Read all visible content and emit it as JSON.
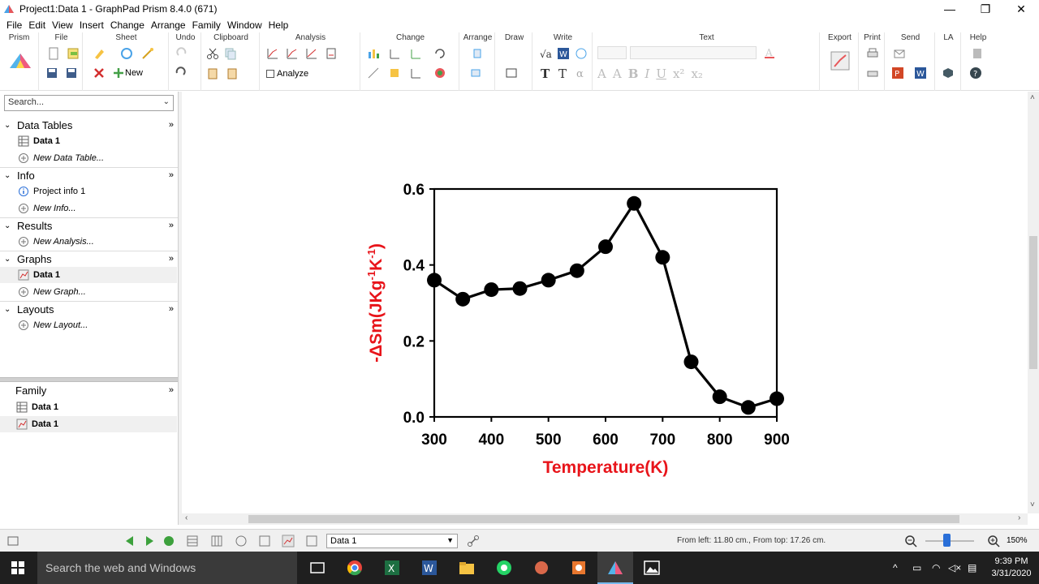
{
  "window": {
    "title": "Project1:Data 1 - GraphPad Prism 8.4.0 (671)",
    "controls": {
      "minimize": "—",
      "restore": "❐",
      "close": "✕"
    }
  },
  "menu": [
    "File",
    "Edit",
    "View",
    "Insert",
    "Change",
    "Arrange",
    "Family",
    "Window",
    "Help"
  ],
  "ribbon": {
    "groups": [
      "Prism",
      "File",
      "Sheet",
      "Undo",
      "Clipboard",
      "Analysis",
      "Change",
      "Arrange",
      "Draw",
      "Write",
      "Text",
      "Export",
      "Print",
      "Send",
      "LA",
      "Help"
    ],
    "new_label": "New",
    "analyze_label": "Analyze"
  },
  "navigator": {
    "search_placeholder": "Search...",
    "sections": [
      {
        "label": "Data Tables",
        "items": [
          {
            "label": "Data 1",
            "style": "bold"
          },
          {
            "label": "New Data Table...",
            "style": "italic"
          }
        ]
      },
      {
        "label": "Info",
        "items": [
          {
            "label": "Project info 1",
            "style": "normal"
          },
          {
            "label": "New Info...",
            "style": "italic"
          }
        ]
      },
      {
        "label": "Results",
        "items": [
          {
            "label": "New Analysis...",
            "style": "italic"
          }
        ]
      },
      {
        "label": "Graphs",
        "items": [
          {
            "label": "Data 1",
            "style": "bold",
            "selected": true
          },
          {
            "label": "New Graph...",
            "style": "italic"
          }
        ]
      },
      {
        "label": "Layouts",
        "items": [
          {
            "label": "New Layout...",
            "style": "italic"
          }
        ]
      }
    ]
  },
  "family": {
    "title": "Family",
    "items": [
      "Data 1",
      "Data 1"
    ]
  },
  "chart_data": {
    "type": "line",
    "x": [
      300,
      350,
      400,
      450,
      500,
      550,
      600,
      650,
      700,
      750,
      800,
      850,
      900
    ],
    "series": [
      {
        "values": [
          0.36,
          0.31,
          0.335,
          0.338,
          0.36,
          0.385,
          0.448,
          0.562,
          0.42,
          0.145,
          0.053,
          0.025,
          0.048
        ],
        "color": "#000000",
        "marker": "circle"
      }
    ],
    "xlabel": "Temperature(K)",
    "ylabel_main": "-ΔSm(JKg",
    "ylabel_sup1": "-1",
    "ylabel_mid": "K",
    "ylabel_sup2": "-1",
    "ylabel_end": ")",
    "label_color": "#e8141a",
    "xlim": [
      300,
      900
    ],
    "ylim": [
      0,
      0.6
    ],
    "xticks": [
      "300",
      "400",
      "500",
      "600",
      "700",
      "800",
      "900"
    ],
    "yticks": [
      "0.0",
      "0.2",
      "0.4",
      "0.6"
    ],
    "grid": false
  },
  "status": {
    "sheet_select": "Data 1",
    "coords": "From left: 11.80 cm., From top: 17.26 cm.",
    "zoom": "150%"
  },
  "taskbar": {
    "search": "Search the web and Windows",
    "time": "9:39 PM",
    "date": "3/31/2020"
  }
}
